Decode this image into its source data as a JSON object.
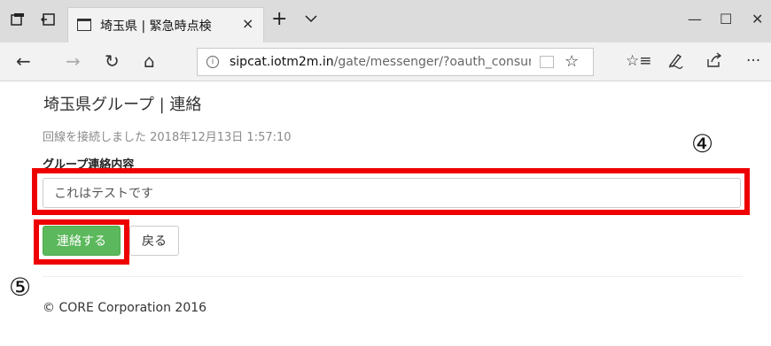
{
  "browser": {
    "tab": {
      "title": "埼玉県 | 緊急時点検"
    },
    "address": {
      "domain": "sipcat.iotm2m.in",
      "path": "/gate/messenger/?oauth_consumer_"
    },
    "icons": {
      "tab_actions": "tab-actions-icon",
      "tab_back": "tab-aside-icon",
      "favicon": "page-icon",
      "close": "×",
      "new_tab": "+",
      "tab_menu": "chevron-down-icon",
      "minimize": "—",
      "maximize": "☐",
      "window_close": "✕",
      "back": "←",
      "forward": "→",
      "refresh": "↻",
      "home": "⌂",
      "info": "i",
      "star": "☆",
      "favorites": "☆≡",
      "pen": "pen-icon",
      "share": "share-icon",
      "more": "···"
    }
  },
  "page": {
    "title": "埼玉県グループ | 連絡",
    "status": "回線を接続しました 2018年12月13日 1:57:10",
    "field_label": "グループ連絡内容",
    "message_value": "これはテストです",
    "send_label": "連絡する",
    "back_label": "戻る",
    "footer": "© CORE Corporation 2016"
  },
  "annotations": {
    "marker_input": "④",
    "marker_send": "⑤",
    "highlight_color": "#ee0000"
  }
}
